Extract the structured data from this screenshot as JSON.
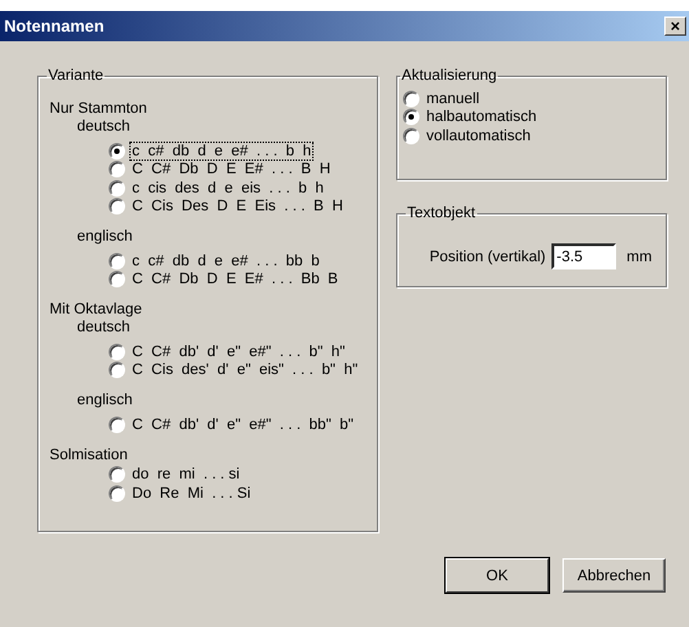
{
  "window": {
    "title": "Notennamen",
    "close": "×"
  },
  "variante": {
    "title": "Variante",
    "sections": [
      {
        "title": "Nur Stammton",
        "groups": [
          {
            "title": "deutsch",
            "options": [
              {
                "label": "c  c#  db  d  e  e#  . . .  b  h",
                "selected": true,
                "focused": true
              },
              {
                "label": "C  C#  Db  D  E  E#  . . .  B  H",
                "selected": false,
                "focused": false
              },
              {
                "label": "c  cis  des  d  e  eis  . . .  b  h",
                "selected": false,
                "focused": false
              },
              {
                "label": "C  Cis  Des  D  E  Eis  . . .  B  H",
                "selected": false,
                "focused": false
              }
            ]
          },
          {
            "title": "englisch",
            "options": [
              {
                "label": "c  c#  db  d  e  e#  . . .  bb  b",
                "selected": false,
                "focused": false
              },
              {
                "label": "C  C#  Db  D  E  E#  . . .  Bb  B",
                "selected": false,
                "focused": false
              }
            ]
          }
        ]
      },
      {
        "title": "Mit Oktavlage",
        "groups": [
          {
            "title": "deutsch",
            "options": [
              {
                "label": "C  C#  db'  d'  e\"  e#\"  . . .  b\"  h\"",
                "selected": false,
                "focused": false
              },
              {
                "label": "C  Cis  des'  d'  e\"  eis\"  . . .  b\"  h\"",
                "selected": false,
                "focused": false
              }
            ]
          },
          {
            "title": "englisch",
            "options": [
              {
                "label": "C  C#  db'  d'  e\"  e#\"  . . .  bb\"  b\"",
                "selected": false,
                "focused": false
              }
            ]
          }
        ]
      },
      {
        "title": "Solmisation",
        "groups": [
          {
            "options": [
              {
                "label": "do  re  mi  . . . si",
                "selected": false,
                "focused": false
              },
              {
                "label": "Do  Re  Mi  . . . Si",
                "selected": false,
                "focused": false
              }
            ]
          }
        ]
      }
    ]
  },
  "aktualisierung": {
    "title": "Aktualisierung",
    "options": [
      {
        "label": "manuell",
        "selected": false
      },
      {
        "label": "halbautomatisch",
        "selected": true
      },
      {
        "label": "vollautomatisch",
        "selected": false
      }
    ]
  },
  "textobjekt": {
    "title": "Textobjekt",
    "label": "Position (vertikal)",
    "value": "-3.5",
    "unit": "mm"
  },
  "buttons": [
    {
      "label": "OK",
      "default": true
    },
    {
      "label": "Abbrechen",
      "default": false
    }
  ]
}
